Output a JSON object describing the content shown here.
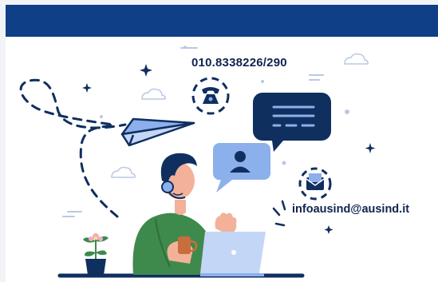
{
  "contact": {
    "phone": "010.8338226/290",
    "email": "infoausind@ausind.it"
  },
  "colors": {
    "header": "#0f3f86",
    "navy": "#0f2f5f",
    "sky": "#8cb0ec",
    "sweater": "#3e8a4c",
    "skin": "#f3b199"
  },
  "icons": [
    "telephone-icon",
    "chat-bubble-icon",
    "user-profile-icon",
    "paper-plane-icon",
    "envelope-icon",
    "laptop-icon",
    "headset-icon",
    "plant-icon",
    "coffee-cup-icon",
    "cloud-icon",
    "sparkle-icon"
  ]
}
